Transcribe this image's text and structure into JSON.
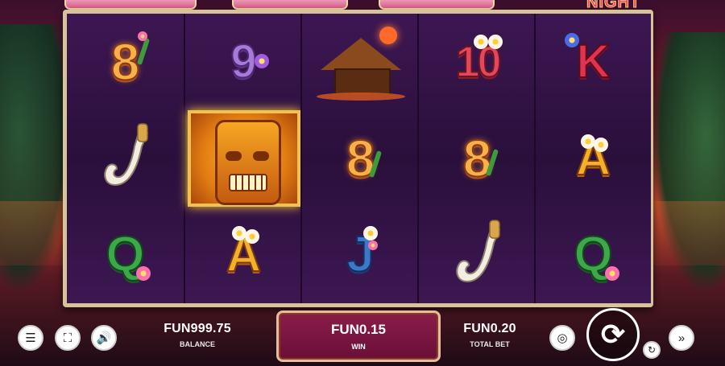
{
  "game": {
    "logo_fragment": "NIGHT",
    "reels": [
      [
        "8",
        "9",
        "hut"
      ],
      [
        "tiki",
        "tiki",
        "tiki"
      ],
      [
        "hut",
        "8",
        "J"
      ],
      [
        "10",
        "8",
        "hook"
      ],
      [
        "K",
        "A",
        "Q"
      ]
    ],
    "visible_grid": [
      [
        "8",
        "9",
        "hut",
        "10",
        "K"
      ],
      [
        "hook",
        "tiki",
        "8",
        "8",
        "A"
      ],
      [
        "Q",
        "A",
        "J",
        "hook",
        "Q"
      ]
    ]
  },
  "controls": {
    "menu_icon": "hamburger-menu-icon",
    "fullscreen_icon": "fullscreen-icon",
    "sound_icon": "speaker-icon",
    "balance_amount": "FUN999.75",
    "balance_label": "BALANCE",
    "win_amount": "FUN0.15",
    "win_label": "WIN",
    "bet_amount": "FUN0.20",
    "bet_label": "TOTAL BET",
    "coins_icon": "coin-stack-icon",
    "spin_icon": "spin-arrows-icon",
    "autoplay_icon": "autoplay-icon",
    "turbo_icon": "fast-forward-icon"
  },
  "colors": {
    "reel_frame": "#d6c39a",
    "reel_bg": "#2b1038",
    "win_panel": "#7a1540"
  }
}
